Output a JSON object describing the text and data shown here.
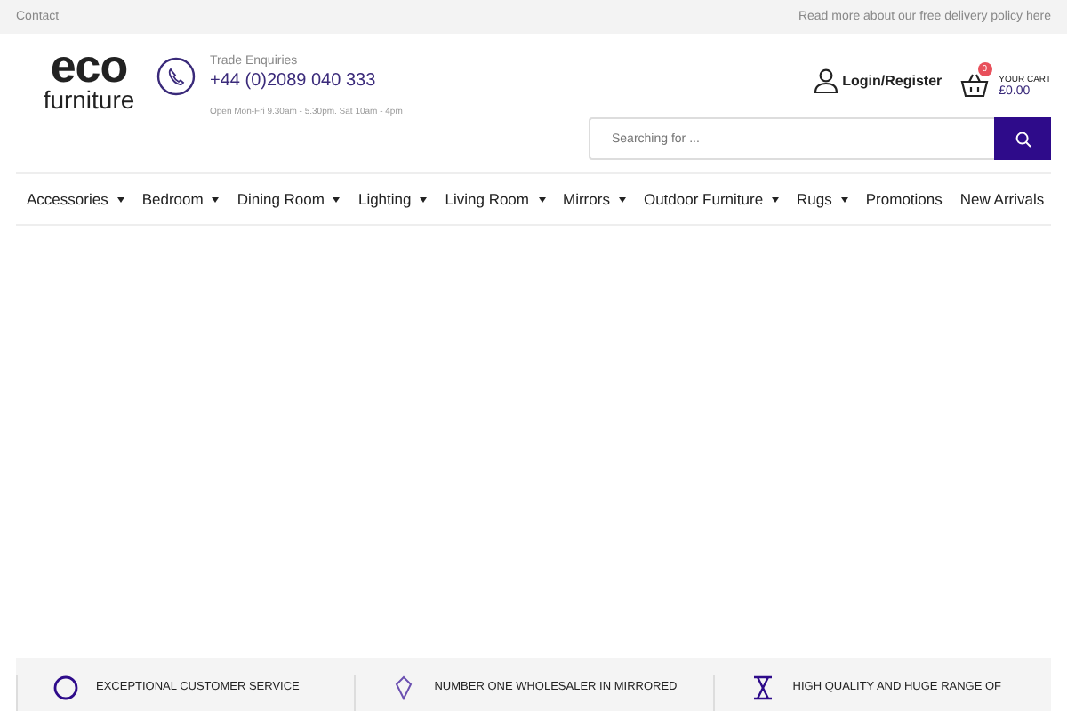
{
  "top_bar": {
    "left_link": "Contact",
    "right_link": "Read more about our free delivery policy here"
  },
  "logo": {
    "line_1": "eco",
    "line_2": "furniture"
  },
  "contact": {
    "label": "Trade Enquiries",
    "phone": "+44 (0)2089 040 333",
    "hours": "Open Mon-Fri 9.30am - 5.30pm. Sat 10am - 4pm"
  },
  "account": {
    "label": "Login/Register"
  },
  "cart": {
    "count": "0",
    "label": "YOUR CART",
    "total": "£0.00"
  },
  "search": {
    "placeholder": "Searching for ..."
  },
  "nav": [
    {
      "label": "Accessories",
      "has_dropdown": true
    },
    {
      "label": "Bedroom",
      "has_dropdown": true
    },
    {
      "label": "Dining Room",
      "has_dropdown": true
    },
    {
      "label": "Lighting",
      "has_dropdown": true
    },
    {
      "label": "Living Room",
      "has_dropdown": true
    },
    {
      "label": "Mirrors",
      "has_dropdown": true
    },
    {
      "label": "Outdoor Furniture",
      "has_dropdown": true
    },
    {
      "label": "Rugs",
      "has_dropdown": true
    },
    {
      "label": "Promotions",
      "has_dropdown": false
    },
    {
      "label": "New Arrivals",
      "has_dropdown": false
    }
  ],
  "features": [
    {
      "kind": "service",
      "text": "EXCEPTIONAL CUSTOMER SERVICE"
    },
    {
      "kind": "mirror",
      "text": "NUMBER ONE WHOLESALER IN MIRRORED"
    },
    {
      "kind": "range",
      "text": "HIGH QUALITY AND HUGE RANGE OF"
    }
  ]
}
